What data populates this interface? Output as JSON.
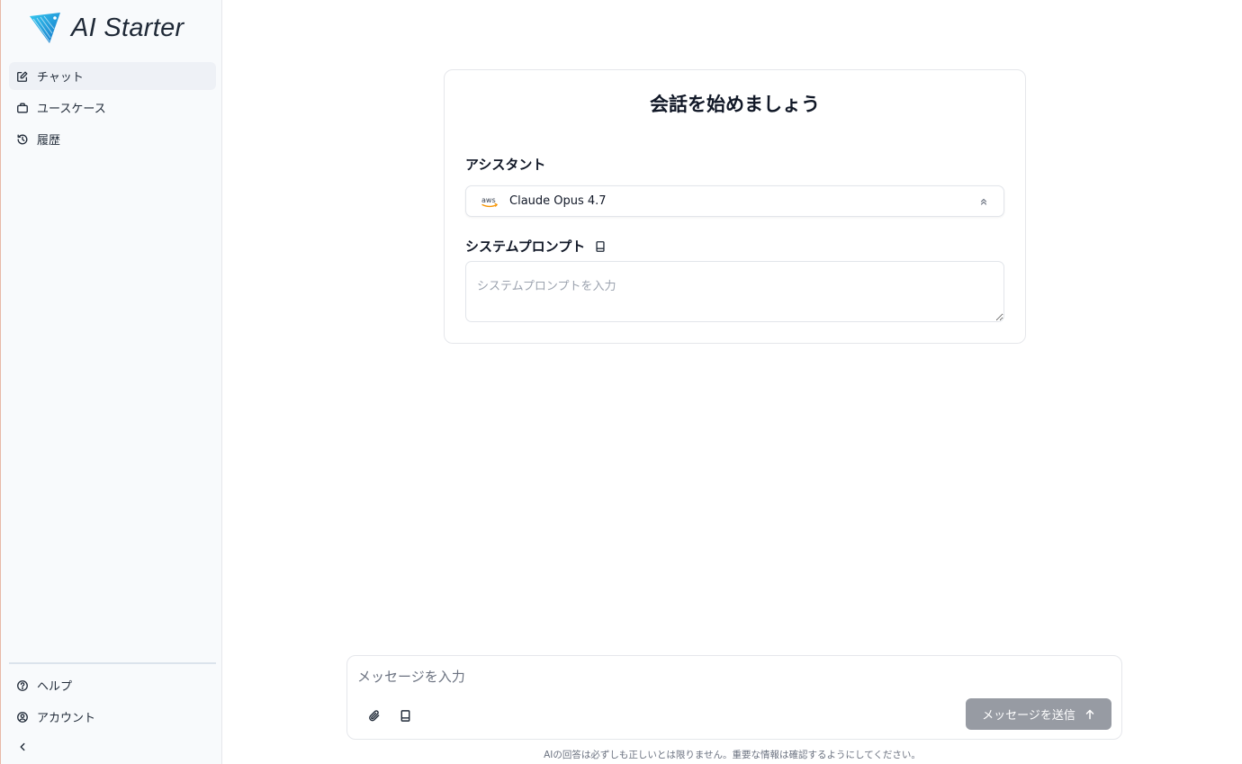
{
  "app": {
    "logo_text": "AI Starter"
  },
  "sidebar": {
    "items": [
      {
        "label": "チャット",
        "icon": "edit-icon",
        "active": true
      },
      {
        "label": "ユースケース",
        "icon": "briefcase-icon",
        "active": false
      },
      {
        "label": "履歴",
        "icon": "history-icon",
        "active": false
      }
    ],
    "bottom_items": [
      {
        "label": "ヘルプ",
        "icon": "help-circle-icon"
      },
      {
        "label": "アカウント",
        "icon": "user-circle-icon"
      }
    ],
    "collapse_icon": "chevron-left-icon"
  },
  "card": {
    "title": "会話を始めましょう",
    "assistant_label": "アシスタント",
    "assistant_value": "Claude Opus 4.7",
    "assistant_provider_icon": "aws-icon",
    "system_prompt_label": "システムプロンプト",
    "system_prompt_placeholder": "システムプロンプトを入力",
    "system_prompt_value": ""
  },
  "composer": {
    "placeholder": "メッセージを入力",
    "value": "",
    "send_label": "メッセージを送信"
  },
  "disclaimer": "AIの回答は必ずしも正しいとは限りません。重要な情報は確認するようにしてください。",
  "colors": {
    "send_button": "#979ba3",
    "sidebar_bg": "#f8fafc",
    "active_item_bg": "#eef1f6",
    "aws_orange": "#f79400",
    "logo_blue": "#1a9cd8"
  }
}
